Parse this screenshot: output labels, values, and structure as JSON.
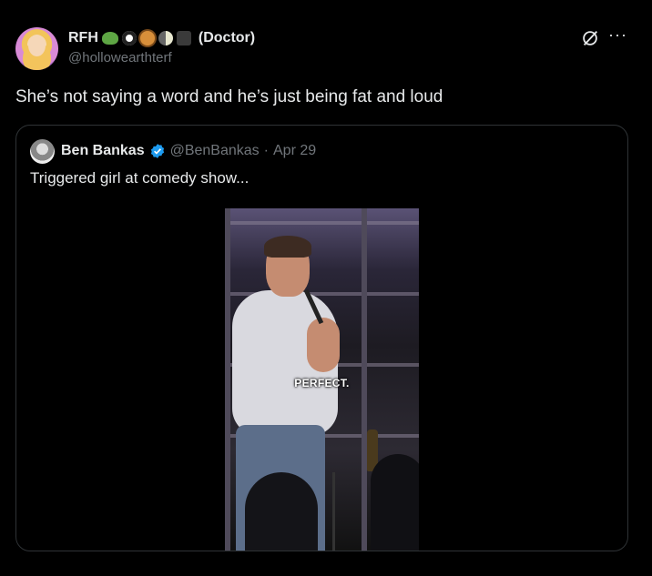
{
  "author": {
    "name": "RFH",
    "emoji_icons": [
      "snake-icon",
      "eye-icon",
      "planet-icon",
      "moon-icon",
      "black-square-icon"
    ],
    "title_suffix": "(Doctor)",
    "handle": "@hollowearthterf"
  },
  "tweet": {
    "text": "She’s not saying a word and he’s just being fat and loud"
  },
  "quote": {
    "name": "Ben Bankas",
    "verified": true,
    "handle": "@BenBankas",
    "separator": "·",
    "date": "Apr 29",
    "text": "Triggered girl at comedy show...",
    "video_caption": "PERFECT."
  },
  "colors": {
    "background": "#000000",
    "text_primary": "#e7e9ea",
    "text_secondary": "#71767b",
    "border": "#2f3336",
    "verified_blue": "#1d9bf0"
  }
}
